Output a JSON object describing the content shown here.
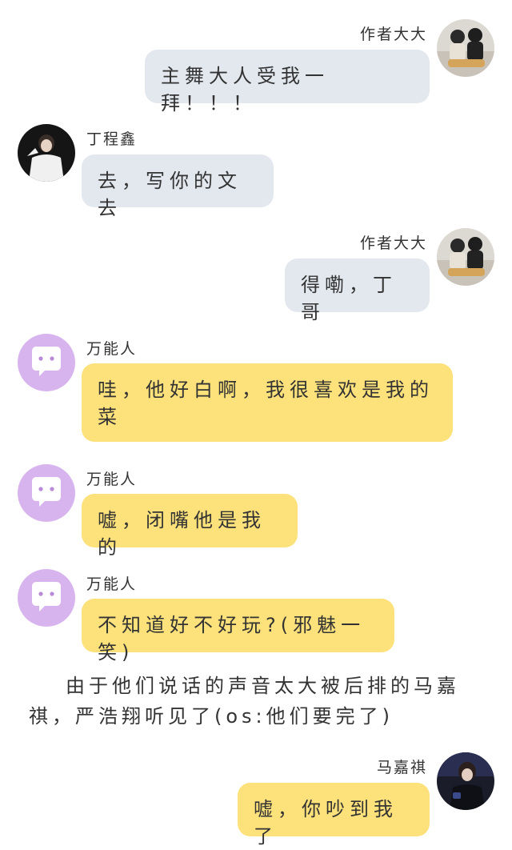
{
  "colors": {
    "grey_bubble": "#e3e8ef",
    "yellow_bubble": "#fde17a",
    "bot_avatar": "#d8b4ef"
  },
  "messages": [
    {
      "sender": "作者大大",
      "text": "主舞大人受我一拜！！！",
      "side": "right",
      "style": "grey",
      "avatar": "author-photo"
    },
    {
      "sender": "丁程鑫",
      "text": "去，写你的文去",
      "side": "left",
      "style": "grey",
      "avatar": "ding-photo"
    },
    {
      "sender": "作者大大",
      "text": "得嘞，丁哥",
      "side": "right",
      "style": "grey",
      "avatar": "author-photo"
    },
    {
      "sender": "万能人",
      "text": "哇，他好白啊，我很喜欢是我的菜",
      "side": "left",
      "style": "yellow",
      "avatar": "chat-bubble-icon"
    },
    {
      "sender": "万能人",
      "text": "嘘，闭嘴他是我的",
      "side": "left",
      "style": "yellow",
      "avatar": "chat-bubble-icon"
    },
    {
      "sender": "万能人",
      "text": "不知道好不好玩?(邪魅一笑)",
      "side": "left",
      "style": "yellow",
      "avatar": "chat-bubble-icon"
    },
    {
      "sender": "马嘉祺",
      "text": "嘘，你吵到我了",
      "side": "right",
      "style": "yellow",
      "avatar": "ma-photo"
    }
  ],
  "narration": "由于他们说话的声音太大被后排的马嘉祺，严浩翔听见了(os:他们要完了)"
}
